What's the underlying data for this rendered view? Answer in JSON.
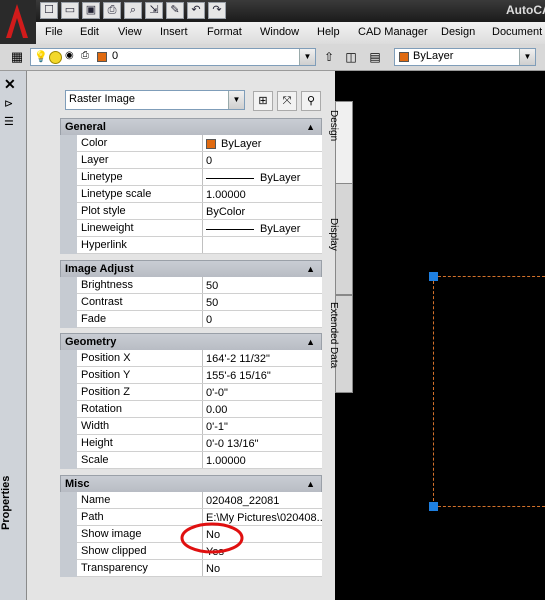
{
  "app": {
    "title": "AutoCA"
  },
  "menu": [
    "File",
    "Edit",
    "View",
    "Insert",
    "Format",
    "Window",
    "Help",
    "CAD Manager",
    "Design",
    "Document"
  ],
  "toolbar": {
    "layer_value": "0",
    "color_value": "ByLayer"
  },
  "palette": {
    "title": "Properties",
    "object_type": "Raster Image",
    "tabs": [
      "Design",
      "Display",
      "Extended Data"
    ],
    "sections": {
      "general": {
        "title": "General",
        "rows": [
          {
            "label": "Color",
            "value": "ByLayer"
          },
          {
            "label": "Layer",
            "value": "0"
          },
          {
            "label": "Linetype",
            "value": "ByLayer"
          },
          {
            "label": "Linetype scale",
            "value": "1.00000"
          },
          {
            "label": "Plot style",
            "value": "ByColor"
          },
          {
            "label": "Lineweight",
            "value": "ByLayer"
          },
          {
            "label": "Hyperlink",
            "value": ""
          }
        ]
      },
      "image_adjust": {
        "title": "Image Adjust",
        "rows": [
          {
            "label": "Brightness",
            "value": "50"
          },
          {
            "label": "Contrast",
            "value": "50"
          },
          {
            "label": "Fade",
            "value": "0"
          }
        ]
      },
      "geometry": {
        "title": "Geometry",
        "rows": [
          {
            "label": "Position X",
            "value": "164'-2 11/32\""
          },
          {
            "label": "Position Y",
            "value": "155'-6 15/16\""
          },
          {
            "label": "Position Z",
            "value": "0'-0\""
          },
          {
            "label": "Rotation",
            "value": "0.00"
          },
          {
            "label": "Width",
            "value": "0'-1\""
          },
          {
            "label": "Height",
            "value": "0'-0 13/16\""
          },
          {
            "label": "Scale",
            "value": "1.00000"
          }
        ]
      },
      "misc": {
        "title": "Misc",
        "rows": [
          {
            "label": "Name",
            "value": "020408_22081"
          },
          {
            "label": "Path",
            "value": "E:\\My Pictures\\020408..."
          },
          {
            "label": "Show image",
            "value": "No"
          },
          {
            "label": "Show clipped",
            "value": "Yes"
          },
          {
            "label": "Transparency",
            "value": "No"
          }
        ]
      }
    }
  },
  "colors": {
    "accent": "#1e7fe0",
    "selection": "#d4712a",
    "color_swatch": "#e06a10",
    "highlight": "#e01010"
  }
}
